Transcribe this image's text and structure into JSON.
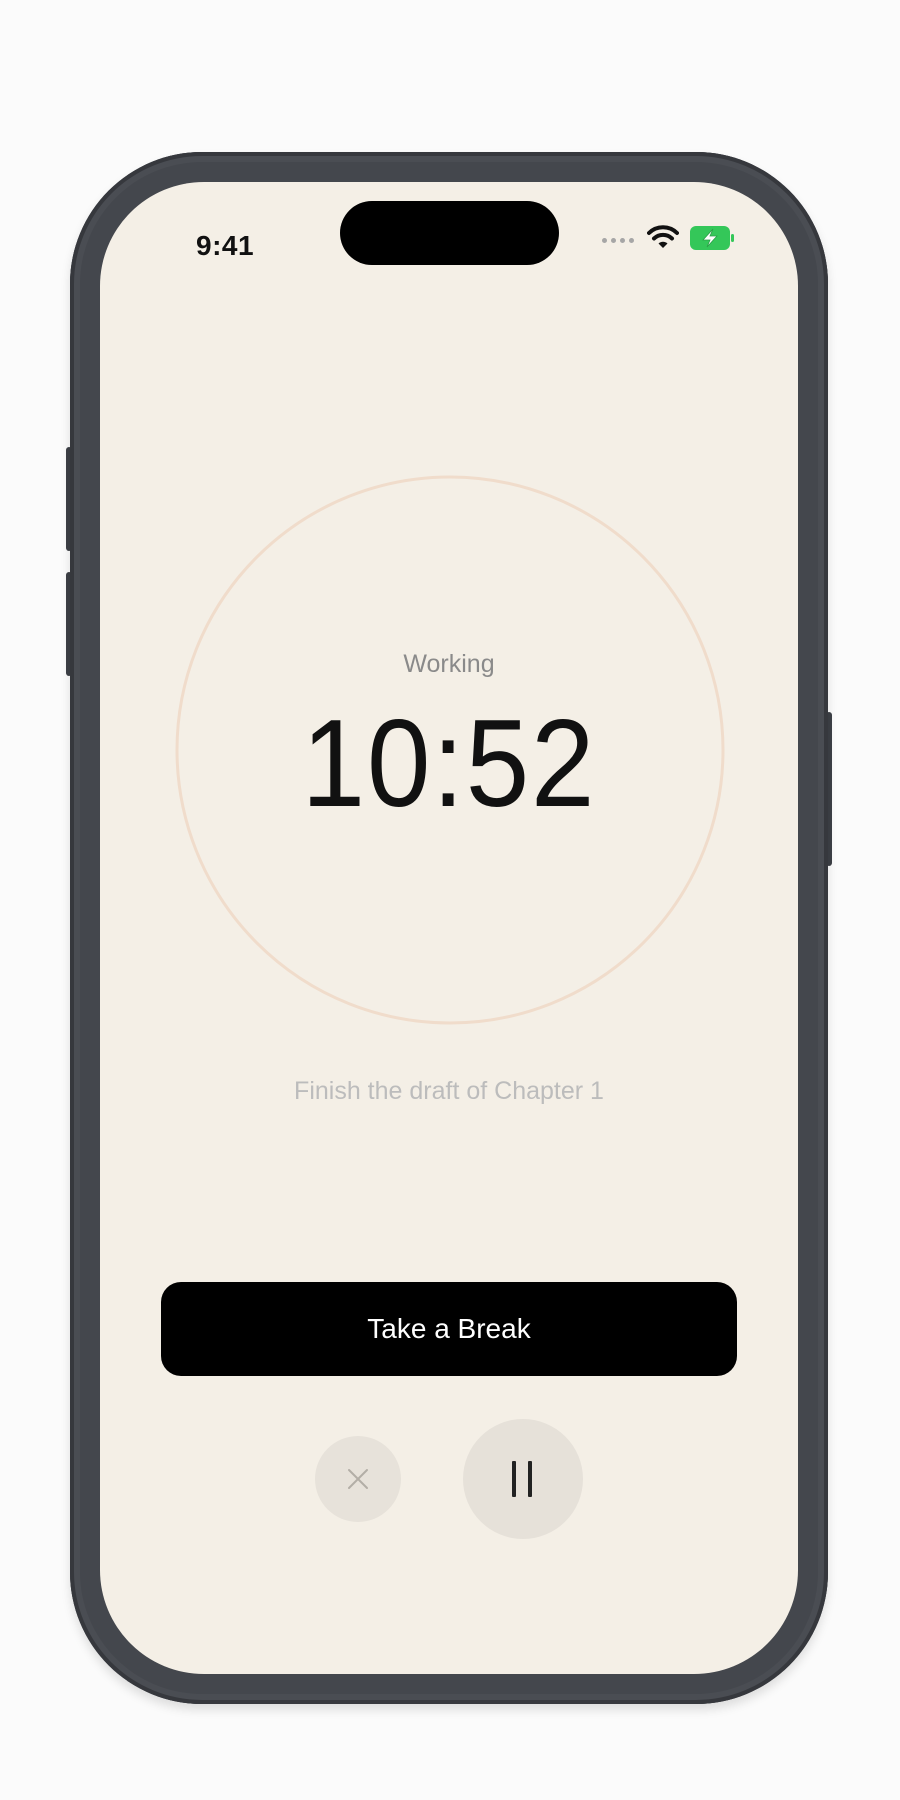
{
  "status_bar": {
    "time": "9:41",
    "icons": [
      "cellular-signal-icon",
      "wifi-icon",
      "battery-charging-icon"
    ]
  },
  "timer": {
    "mode_label": "Working",
    "time_remaining": "10:52",
    "task": "Finish the draft of Chapter 1"
  },
  "actions": {
    "break_label": "Take a Break",
    "stop_icon": "close-icon",
    "pause_icon": "pause-icon"
  },
  "colors": {
    "background": "#f4efe6",
    "ring": "#f0dccb",
    "primary_button": "#000000",
    "battery": "#34c759"
  }
}
